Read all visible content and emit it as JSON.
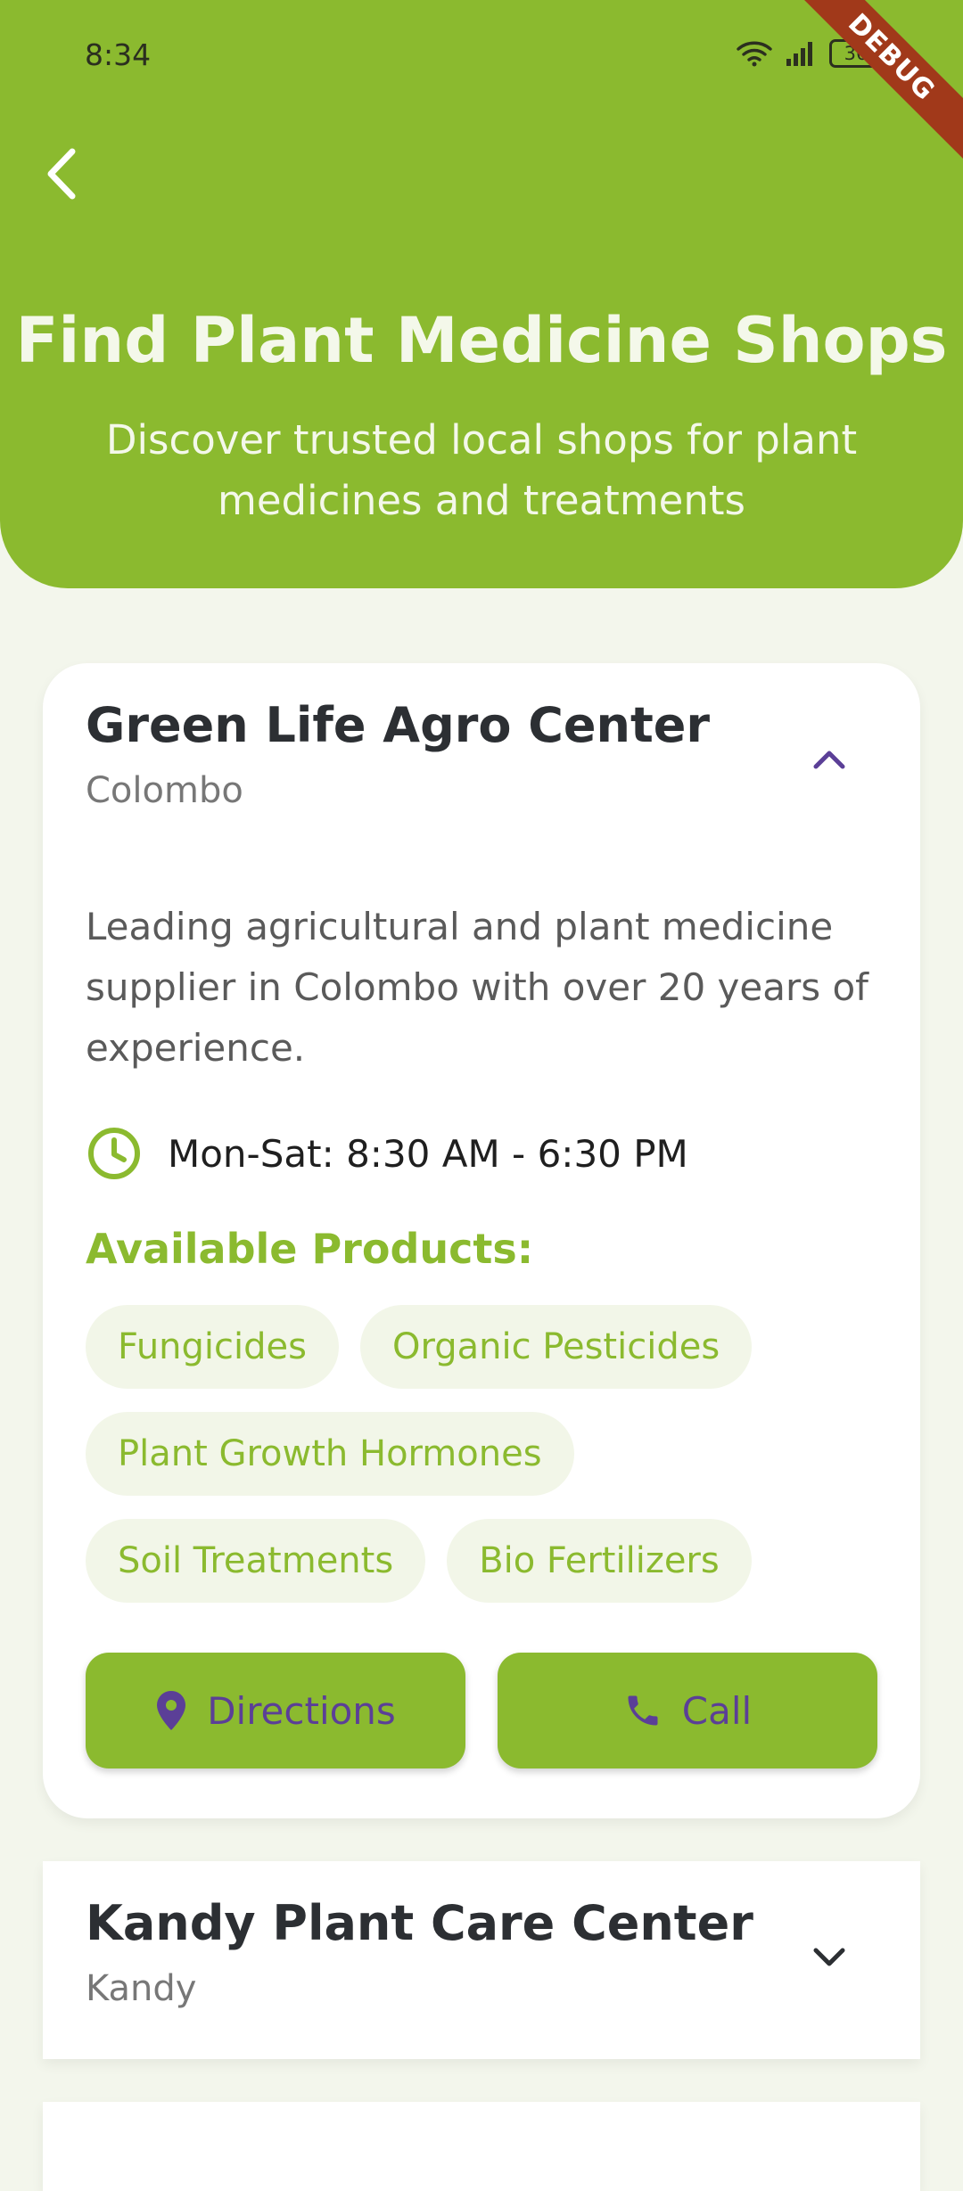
{
  "status_bar": {
    "time": "8:34",
    "battery": "36",
    "debug_label": "DEBUG"
  },
  "header": {
    "title": "Find Plant Medicine Shops",
    "subtitle": "Discover trusted local shops for plant medicines and treatments"
  },
  "shops": [
    {
      "name": "Green Life Agro Center",
      "city": "Colombo",
      "expanded": true,
      "description": "Leading agricultural and plant medicine supplier in Colombo with over 20 years of experience.",
      "hours": "Mon-Sat: 8:30 AM - 6:30 PM",
      "products_title": "Available Products:",
      "products": [
        "Fungicides",
        "Organic Pesticides",
        "Plant Growth Hormones",
        "Soil Treatments",
        "Bio Fertilizers"
      ],
      "directions_label": "Directions",
      "call_label": "Call"
    },
    {
      "name": "Kandy Plant Care Center",
      "city": "Kandy",
      "expanded": false
    }
  ],
  "colors": {
    "primary": "#8bba2f",
    "icon_accent": "#5b3f97",
    "background": "#f3f6ec",
    "chip_bg": "#f2f6e8",
    "debug_ribbon": "#a1391a"
  },
  "icons": {
    "back": "chevron-left-icon",
    "expand_open": "chevron-up-icon",
    "expand_closed": "chevron-down-icon",
    "hours": "clock-icon",
    "directions": "location-pin-icon",
    "call": "phone-icon"
  }
}
